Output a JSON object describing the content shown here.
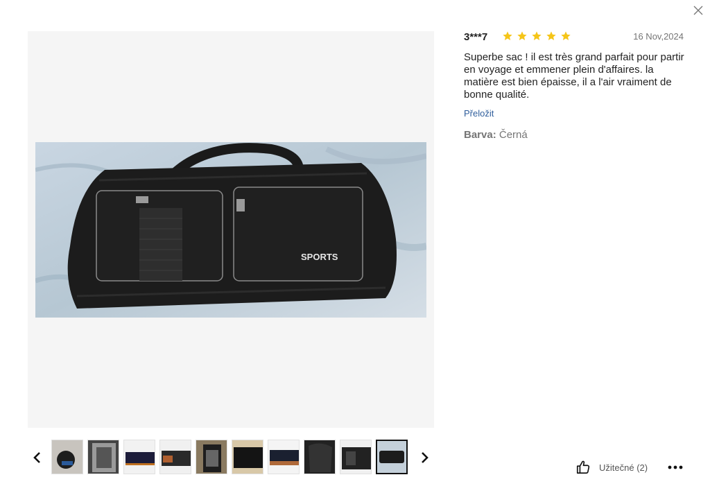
{
  "dialog": {
    "close_icon": "close-icon"
  },
  "review": {
    "reviewer": "3***7",
    "rating": 5,
    "rating_max": 5,
    "star_color": "#f5c518",
    "date": "16 Nov,2024",
    "text": "Superbe sac ! il est très grand parfait pour partir en voyage et emmener plein d'affaires. la matière est bien épaisse, il a l'air vraiment de bonne qualité.",
    "translate_label": "Přeložit",
    "translate_color": "#2f5e9c",
    "color_label": "Barva:",
    "color_value": "Černá"
  },
  "main_image": {
    "logo_text": "SPORTS"
  },
  "gallery": {
    "prev_icon": "chevron-left-icon",
    "next_icon": "chevron-right-icon",
    "thumbnail_count": 10,
    "selected_index": 9
  },
  "actions": {
    "helpful_label": "Užitečné (2)",
    "helpful_icon": "thumbs-up-icon",
    "more_icon": "more-dots-icon"
  }
}
